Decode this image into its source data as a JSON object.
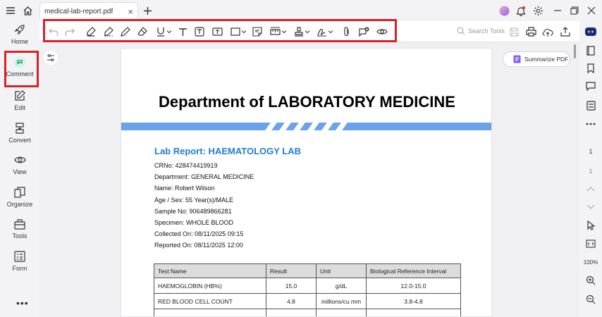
{
  "tab": {
    "title": "medical-lab-report.pdf"
  },
  "toolbar": {
    "search_placeholder": "Search Tools"
  },
  "leftnav": {
    "items": [
      {
        "label": "Home"
      },
      {
        "label": "Comment"
      },
      {
        "label": "Edit"
      },
      {
        "label": "Convert"
      },
      {
        "label": "View"
      },
      {
        "label": "Organize"
      },
      {
        "label": "Tools"
      },
      {
        "label": "Form"
      }
    ],
    "more": "•••"
  },
  "summarize": {
    "label": "Summarize PDF"
  },
  "document": {
    "department": "Department of LABORATORY MEDICINE",
    "report_title": "Lab Report: HAEMATOLOGY LAB",
    "info": [
      "CRNo: 428474419919",
      "Department: GENERAL MEDICINE",
      "Name: Robert Wilson",
      "Age / Sex: 55 Year(s)/MALE",
      "Sample No: 906489866281",
      "Specimen: WHOLE BLOOD",
      "Collected On: 08/11/2025 09:15",
      "Reported On: 08/11/2025 12:00"
    ],
    "table": {
      "headers": [
        "Test Name",
        "Result",
        "Unit",
        "Biological Reference Interval"
      ],
      "rows": [
        [
          "HAEMOGLOBIN (HB%)",
          "15.0",
          "g/dL",
          "12.0-15.0"
        ],
        [
          "RED BLOOD CELL COUNT",
          "4.8",
          "millions/cu mm",
          "3.8-4.8"
        ]
      ]
    }
  },
  "rightbar": {
    "page_current": "1",
    "page_total": "1",
    "zoom": "100%"
  },
  "colors": {
    "accent": "#1f7ed6",
    "highlight_box": "#d8212b",
    "stripe": "#6aa3ea"
  }
}
